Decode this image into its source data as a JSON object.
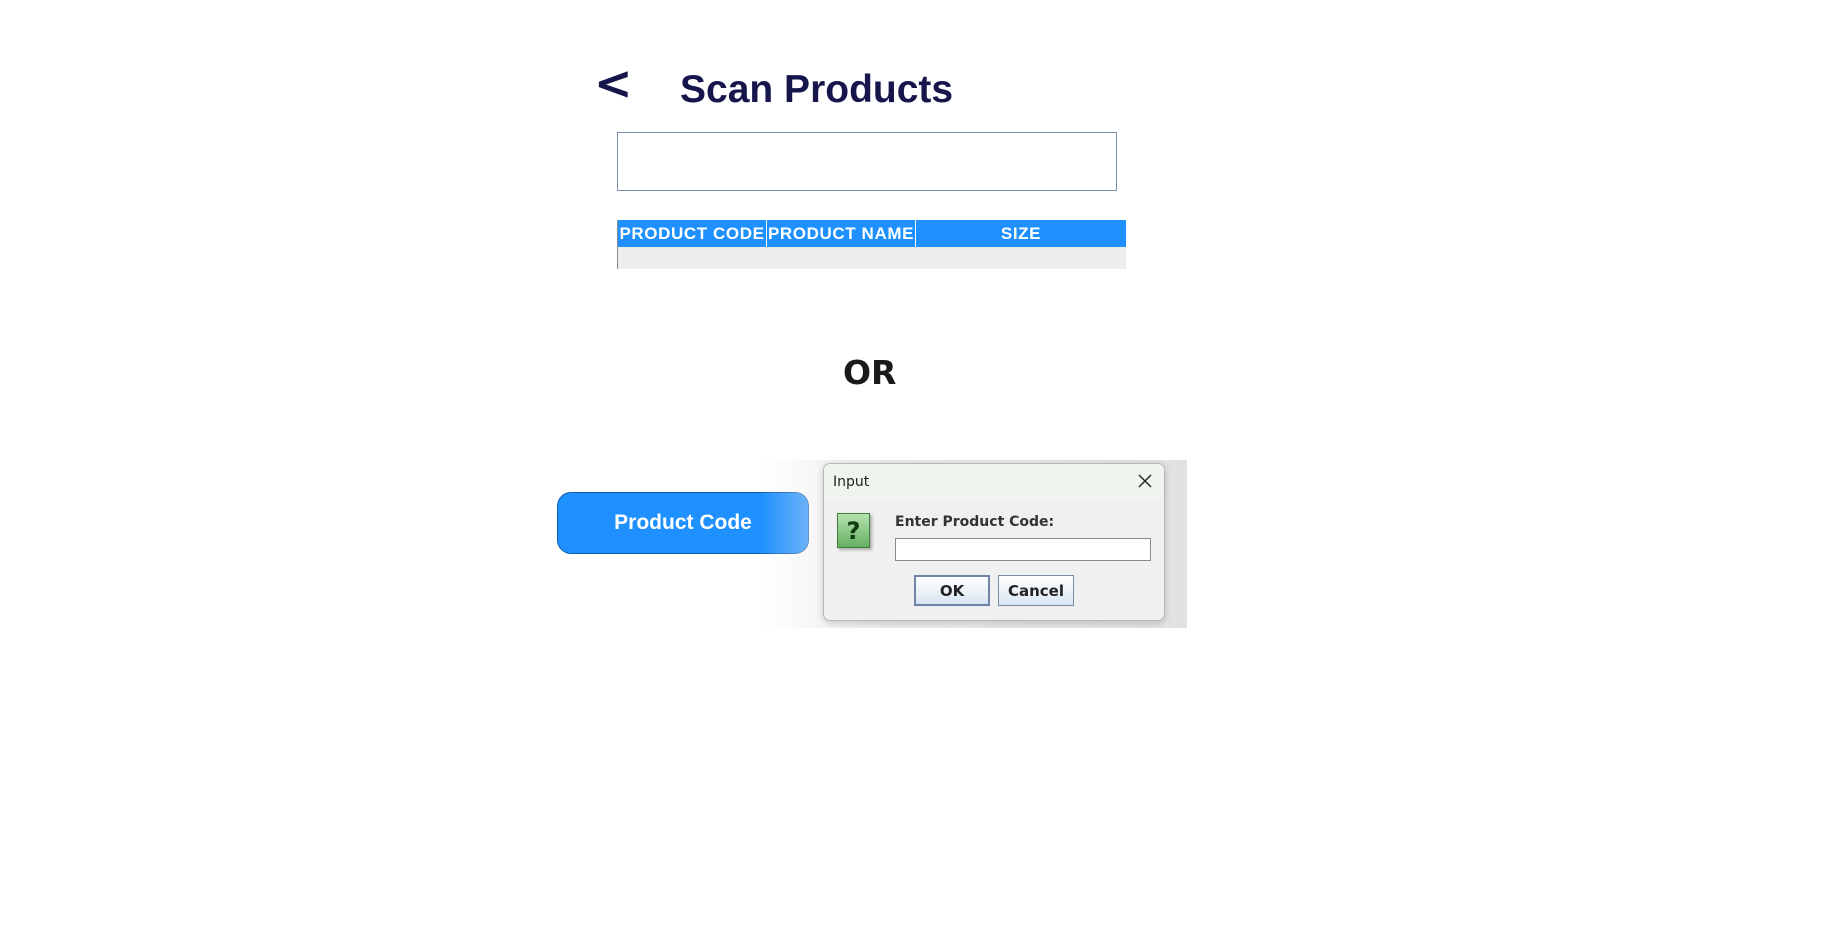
{
  "header": {
    "back_label": "<",
    "title": "Scan Products"
  },
  "scan": {
    "value": "",
    "placeholder": ""
  },
  "table": {
    "columns": [
      "PRODUCT CODE",
      "PRODUCT NAME",
      "SIZE"
    ],
    "rows": []
  },
  "divider": {
    "or_label": "OR"
  },
  "product_code_button": {
    "label": "Product Code"
  },
  "dialog": {
    "title": "Input",
    "icon": "question-icon",
    "icon_glyph": "?",
    "prompt": "Enter Product Code:",
    "input_value": "",
    "ok_label": "OK",
    "cancel_label": "Cancel"
  },
  "colors": {
    "accent": "#1e90ff",
    "title_text": "#16164d"
  }
}
